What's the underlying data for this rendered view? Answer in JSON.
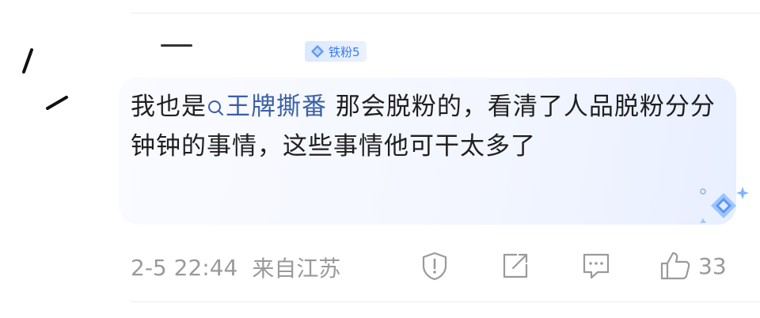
{
  "comment": {
    "badge_label": "铁粉5",
    "text_before_link": "我也是",
    "link_text": "王牌撕番",
    "text_after_link": " 那会脱粉的，看清了人品脱粉分分钟钟的事情，这些事情他可干太多了"
  },
  "meta": {
    "timestamp": "2-5 22:44",
    "location": "来自江苏"
  },
  "actions": {
    "like_count": "33"
  },
  "colors": {
    "link": "#3a5fa8",
    "badge": "#3a7bf0",
    "meta": "#9a9a9a"
  }
}
